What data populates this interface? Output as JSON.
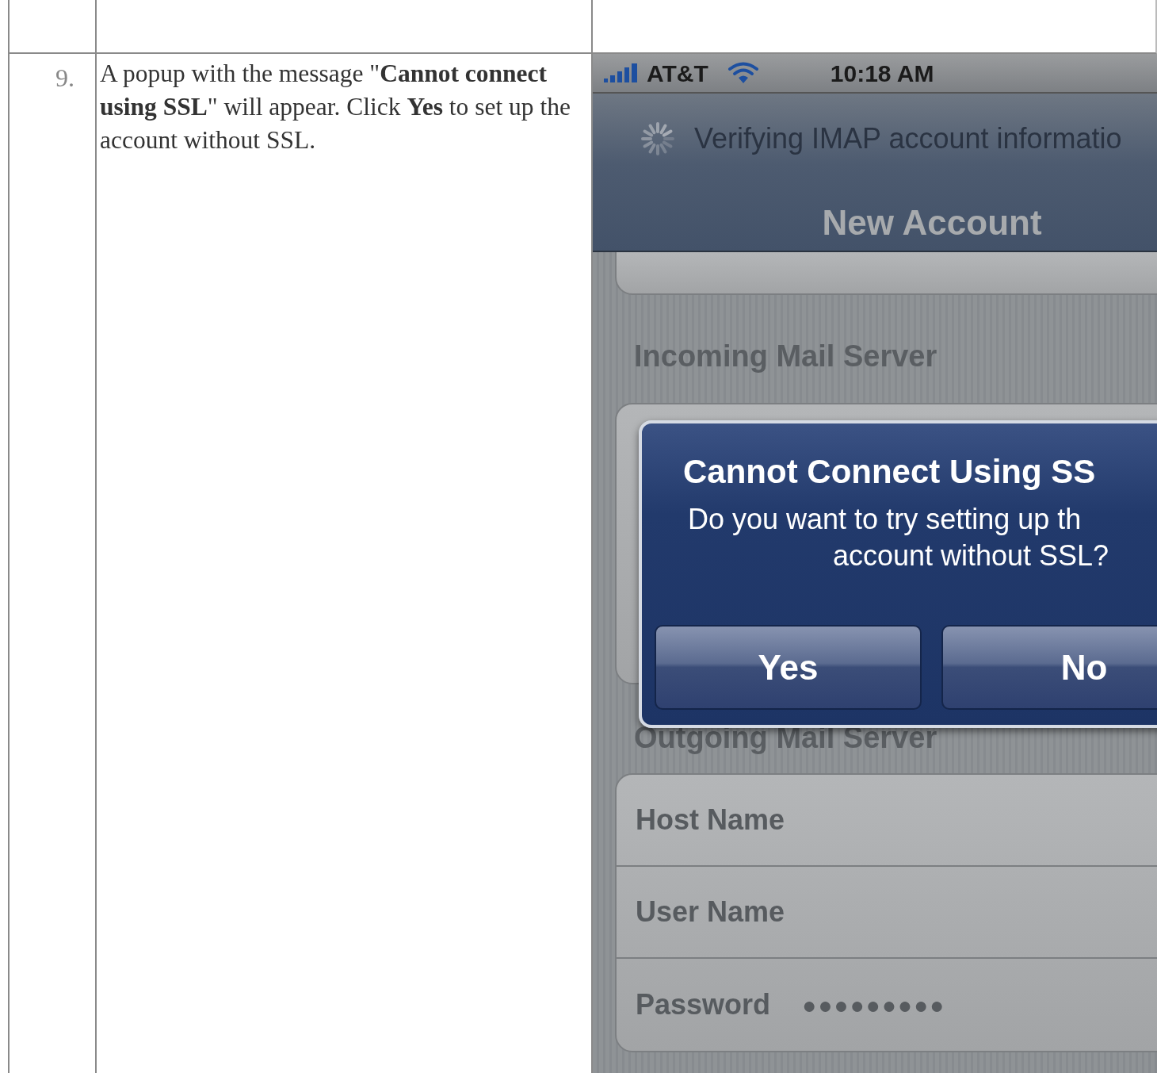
{
  "step": {
    "number": "9.",
    "instruction": "A popup with the message \"**Cannot connect using SSL**\" will appear. Click **Yes** to set up the account without SSL."
  },
  "phone": {
    "status_bar": {
      "carrier": "AT&T",
      "time": "10:18 AM"
    },
    "nav_bar": {
      "prompt": "Verifying IMAP account informatio",
      "title": "New Account"
    },
    "sections": [
      {
        "header": "Incoming Mail Server"
      },
      {
        "header": "Outgoing Mail Server",
        "rows": [
          {
            "label": "Host Name"
          },
          {
            "label": "User Name"
          },
          {
            "label": "Password",
            "value": "●●●●●●●●●"
          }
        ]
      }
    ],
    "alert": {
      "title": "Cannot Connect Using SS",
      "message_lines": [
        "Do you want to try setting up th",
        "account without SSL?"
      ],
      "buttons": [
        {
          "label": "Yes"
        },
        {
          "label": "No"
        }
      ]
    }
  }
}
